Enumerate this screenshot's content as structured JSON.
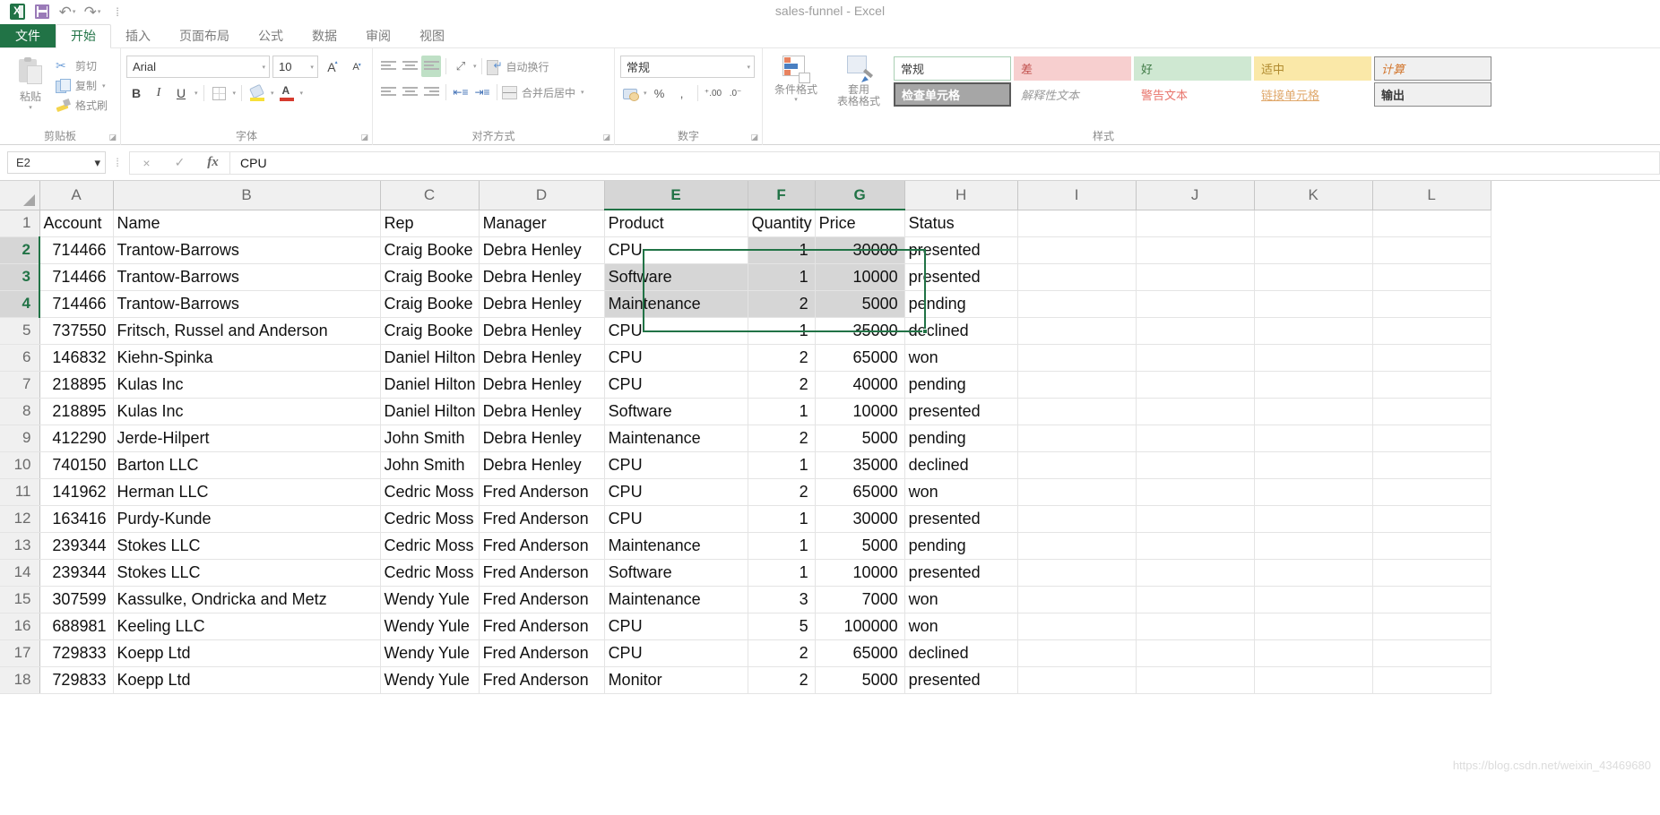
{
  "title_bar": {
    "document_title": "sales-funnel - Excel",
    "qat": [
      {
        "name": "excel-logo",
        "label": "X"
      },
      {
        "name": "save-icon",
        "label": "保存"
      },
      {
        "name": "undo-icon",
        "label": "撤消"
      },
      {
        "name": "redo-icon",
        "label": "恢复"
      },
      {
        "name": "customize-qat-icon",
        "label": "自定义快速访问工具栏"
      }
    ]
  },
  "ribbon": {
    "tabs": [
      {
        "label": "文件",
        "active": false,
        "is_file": true
      },
      {
        "label": "开始",
        "active": true
      },
      {
        "label": "插入",
        "active": false
      },
      {
        "label": "页面布局",
        "active": false
      },
      {
        "label": "公式",
        "active": false
      },
      {
        "label": "数据",
        "active": false
      },
      {
        "label": "审阅",
        "active": false
      },
      {
        "label": "视图",
        "active": false
      }
    ],
    "groups": {
      "clipboard": {
        "label": "剪贴板",
        "paste": "粘贴",
        "cut": "剪切",
        "copy": "复制",
        "format_painter": "格式刷"
      },
      "font": {
        "label": "字体",
        "font_name": "Arial",
        "font_size": "10",
        "bold": "B",
        "italic": "I",
        "underline": "U"
      },
      "alignment": {
        "label": "对齐方式",
        "wrap_text": "自动换行",
        "merge_center": "合并后居中"
      },
      "number": {
        "label": "数字",
        "format_value": "常规"
      },
      "styles": {
        "label": "样式",
        "conditional_formatting": "条件格式",
        "format_as_table": "套用\n表格格式",
        "cell_styles": [
          {
            "label": "常规",
            "style": "gs-normal"
          },
          {
            "label": "差",
            "style": "gs-bad"
          },
          {
            "label": "好",
            "style": "gs-good"
          },
          {
            "label": "适中",
            "style": "gs-neutral"
          },
          {
            "label": "计算",
            "style": "gs-calc"
          },
          {
            "label": "检查单元格",
            "style": "gs-check"
          },
          {
            "label": "解释性文本",
            "style": "gs-explain"
          },
          {
            "label": "警告文本",
            "style": "gs-warn"
          },
          {
            "label": "链接单元格",
            "style": "gs-link"
          },
          {
            "label": "输出",
            "style": "gs-output"
          }
        ]
      }
    }
  },
  "formula_bar": {
    "name_box": "E2",
    "formula_value": "CPU",
    "cancel_label": "×",
    "enter_label": "✓",
    "fx_label": "fx"
  },
  "sheet": {
    "columns": [
      "A",
      "B",
      "C",
      "D",
      "E",
      "F",
      "G",
      "H",
      "I",
      "J",
      "K",
      "L"
    ],
    "selected_columns": [
      "E",
      "F",
      "G"
    ],
    "selected_rows": [
      2,
      3,
      4
    ],
    "active_cell": "E2",
    "selection_range": "E2:G4",
    "headers": {
      "A": "Account",
      "B": "Name",
      "C": "Rep",
      "D": "Manager",
      "E": "Product",
      "F": "Quantity",
      "G": "Price",
      "H": "Status"
    },
    "rows": [
      {
        "n": 1,
        "A": "Account",
        "B": "Name",
        "C": "Rep",
        "D": "Manager",
        "E": "Product",
        "F": "Quantity",
        "G": "Price",
        "H": "Status",
        "is_header": true
      },
      {
        "n": 2,
        "A": "714466",
        "B": "Trantow-Barrows",
        "C": "Craig Booke",
        "D": "Debra Henley",
        "E": "CPU",
        "F": "1",
        "G": "30000",
        "H": "presented"
      },
      {
        "n": 3,
        "A": "714466",
        "B": "Trantow-Barrows",
        "C": "Craig Booke",
        "D": "Debra Henley",
        "E": "Software",
        "F": "1",
        "G": "10000",
        "H": "presented"
      },
      {
        "n": 4,
        "A": "714466",
        "B": "Trantow-Barrows",
        "C": "Craig Booke",
        "D": "Debra Henley",
        "E": "Maintenance",
        "F": "2",
        "G": "5000",
        "H": "pending"
      },
      {
        "n": 5,
        "A": "737550",
        "B": "Fritsch, Russel and Anderson",
        "C": "Craig Booke",
        "D": "Debra Henley",
        "E": "CPU",
        "F": "1",
        "G": "35000",
        "H": "declined"
      },
      {
        "n": 6,
        "A": "146832",
        "B": "Kiehn-Spinka",
        "C": "Daniel Hilton",
        "D": "Debra Henley",
        "E": "CPU",
        "F": "2",
        "G": "65000",
        "H": "won"
      },
      {
        "n": 7,
        "A": "218895",
        "B": "Kulas Inc",
        "C": "Daniel Hilton",
        "D": "Debra Henley",
        "E": "CPU",
        "F": "2",
        "G": "40000",
        "H": "pending"
      },
      {
        "n": 8,
        "A": "218895",
        "B": "Kulas Inc",
        "C": "Daniel Hilton",
        "D": "Debra Henley",
        "E": "Software",
        "F": "1",
        "G": "10000",
        "H": "presented"
      },
      {
        "n": 9,
        "A": "412290",
        "B": "Jerde-Hilpert",
        "C": "John Smith",
        "D": "Debra Henley",
        "E": "Maintenance",
        "F": "2",
        "G": "5000",
        "H": "pending"
      },
      {
        "n": 10,
        "A": "740150",
        "B": "Barton LLC",
        "C": "John Smith",
        "D": "Debra Henley",
        "E": "CPU",
        "F": "1",
        "G": "35000",
        "H": "declined"
      },
      {
        "n": 11,
        "A": "141962",
        "B": "Herman LLC",
        "C": "Cedric Moss",
        "D": "Fred Anderson",
        "E": "CPU",
        "F": "2",
        "G": "65000",
        "H": "won"
      },
      {
        "n": 12,
        "A": "163416",
        "B": "Purdy-Kunde",
        "C": "Cedric Moss",
        "D": "Fred Anderson",
        "E": "CPU",
        "F": "1",
        "G": "30000",
        "H": "presented"
      },
      {
        "n": 13,
        "A": "239344",
        "B": "Stokes LLC",
        "C": "Cedric Moss",
        "D": "Fred Anderson",
        "E": "Maintenance",
        "F": "1",
        "G": "5000",
        "H": "pending"
      },
      {
        "n": 14,
        "A": "239344",
        "B": "Stokes LLC",
        "C": "Cedric Moss",
        "D": "Fred Anderson",
        "E": "Software",
        "F": "1",
        "G": "10000",
        "H": "presented"
      },
      {
        "n": 15,
        "A": "307599",
        "B": "Kassulke, Ondricka and Metz",
        "C": "Wendy Yule",
        "D": "Fred Anderson",
        "E": "Maintenance",
        "F": "3",
        "G": "7000",
        "H": "won"
      },
      {
        "n": 16,
        "A": "688981",
        "B": "Keeling LLC",
        "C": "Wendy Yule",
        "D": "Fred Anderson",
        "E": "CPU",
        "F": "5",
        "G": "100000",
        "H": "won"
      },
      {
        "n": 17,
        "A": "729833",
        "B": "Koepp Ltd",
        "C": "Wendy Yule",
        "D": "Fred Anderson",
        "E": "CPU",
        "F": "2",
        "G": "65000",
        "H": "declined"
      },
      {
        "n": 18,
        "A": "729833",
        "B": "Koepp Ltd",
        "C": "Wendy Yule",
        "D": "Fred Anderson",
        "E": "Monitor",
        "F": "2",
        "G": "5000",
        "H": "presented"
      }
    ]
  },
  "watermark": "https://blog.csdn.net/weixin_43469680",
  "colors": {
    "excel_green": "#217346",
    "selection_green": "#217346",
    "header_gray": "#f0f0f0",
    "selected_header": "#d6d6d6"
  }
}
